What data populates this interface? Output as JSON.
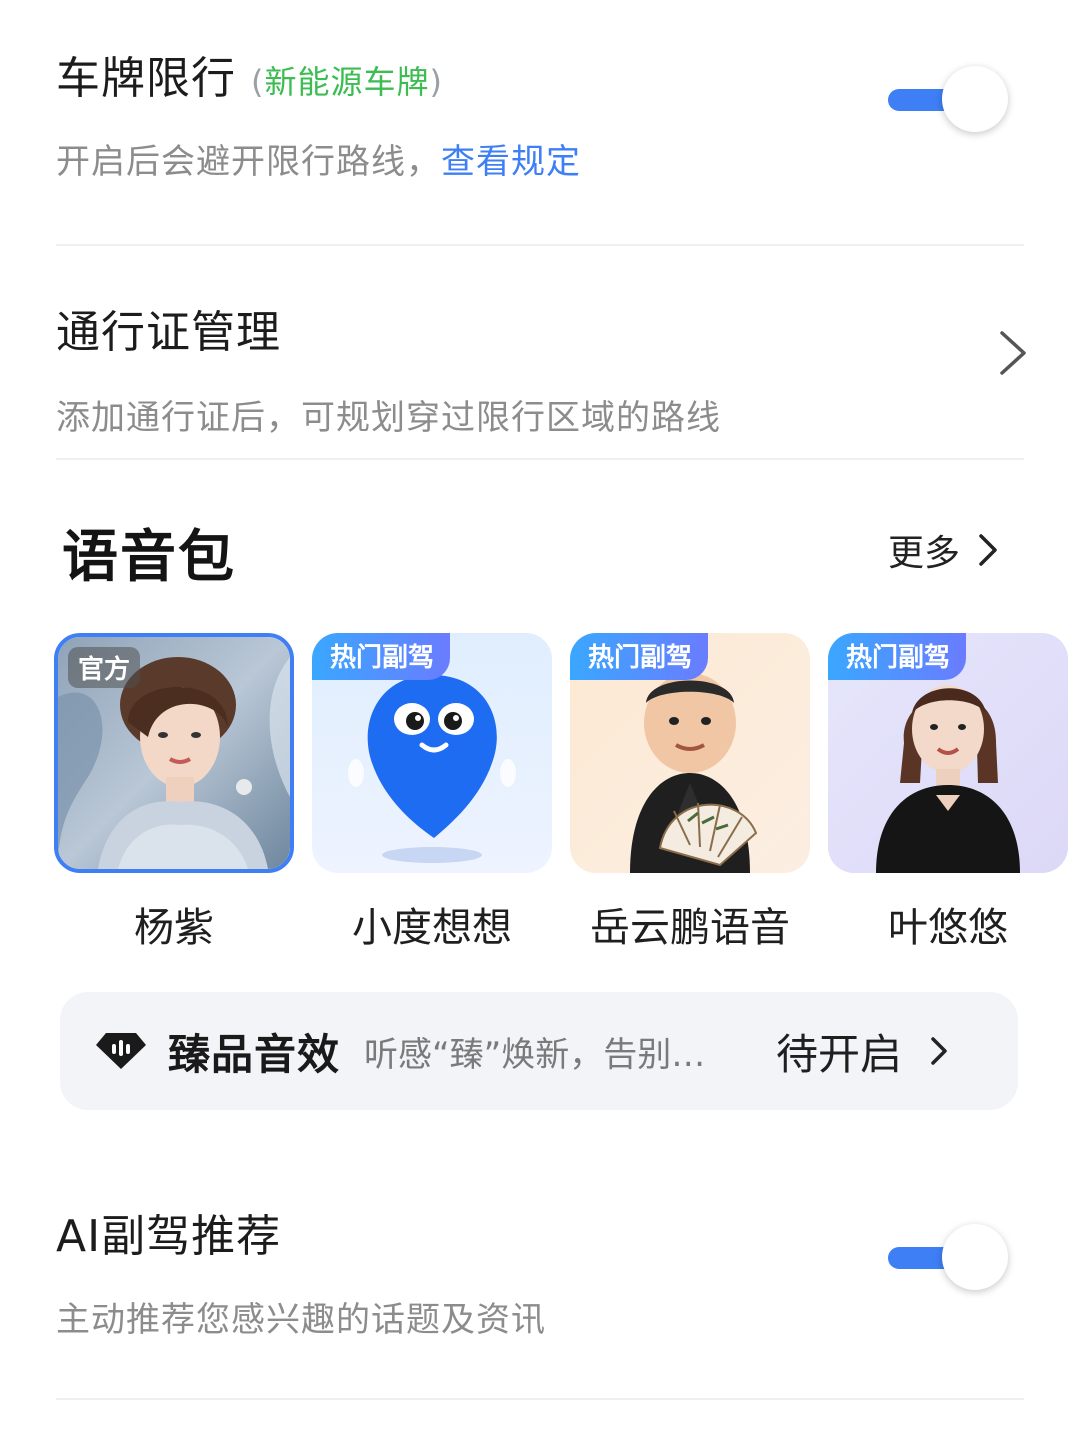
{
  "plate": {
    "title": "车牌限行",
    "tag_open": "(",
    "tag": "新能源车牌",
    "tag_close": ")",
    "desc": "开启后会避开限行路线，",
    "link": "查看规定",
    "enabled": true
  },
  "pass": {
    "title": "通行证管理",
    "desc": "添加通行证后，可规划穿过限行区域的路线"
  },
  "voice": {
    "section_title": "语音包",
    "more_label": "更多",
    "packs": [
      {
        "name": "杨紫",
        "badge": "官方",
        "selected": true
      },
      {
        "name": "小度想想",
        "badge": "热门副驾",
        "selected": false
      },
      {
        "name": "岳云鹏语音",
        "badge": "热门副驾",
        "selected": false
      },
      {
        "name": "叶悠悠",
        "badge": "热门副驾",
        "selected": false
      }
    ]
  },
  "effect": {
    "name": "臻品音效",
    "desc": "听感“臻”焕新，告别…",
    "status": "待开启"
  },
  "ai": {
    "title": "AI副驾推荐",
    "desc": "主动推荐您感兴趣的话题及资讯",
    "enabled": true
  },
  "colors": {
    "accent": "#3e7ff5",
    "tag_green": "#3cbd52"
  }
}
